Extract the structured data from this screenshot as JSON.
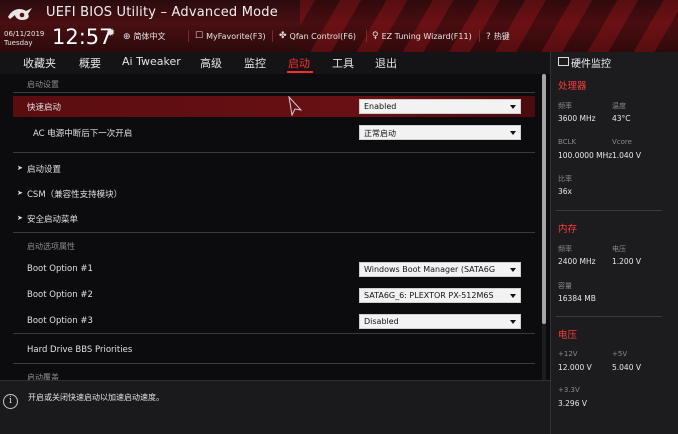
{
  "header": {
    "title": "UEFI BIOS Utility – Advanced Mode",
    "date": "06/11/2019",
    "day": "Tuesday",
    "time": "12:57",
    "items": [
      {
        "icon": "globe-icon",
        "label": "简体中文"
      },
      {
        "icon": "star-icon",
        "label": "MyFavorite(F3)"
      },
      {
        "icon": "fan-icon",
        "label": "Qfan Control(F6)"
      },
      {
        "icon": "bulb-icon",
        "label": "EZ Tuning Wizard(F11)"
      },
      {
        "icon": "hotkey-icon",
        "label": "热键"
      }
    ]
  },
  "tabs": [
    "收藏夹",
    "概要",
    "Ai Tweaker",
    "高级",
    "监控",
    "启动",
    "工具",
    "退出"
  ],
  "active_tab": "启动",
  "main": {
    "section_boot_config": "启动设置",
    "fast_boot": {
      "label": "快速启动",
      "value": "Enabled"
    },
    "ac_power": {
      "label": "AC 电源中断后下一次开启",
      "value": "正常启动"
    },
    "expanders": [
      "启动设置",
      "CSM（兼容性支持模块）",
      "安全启动菜单"
    ],
    "section_boot_options": "启动选项属性",
    "boot_options": [
      {
        "label": "Boot Option #1",
        "value": "Windows Boot Manager (SATA6G"
      },
      {
        "label": "Boot Option #2",
        "value": "SATA6G_6: PLEXTOR PX-512M6S"
      },
      {
        "label": "Boot Option #3",
        "value": "Disabled"
      }
    ],
    "hdd_bbs": "Hard Drive BBS Priorities",
    "partial_next": "启动覆盖"
  },
  "help": {
    "text": "开启或关闭快速启动以加速启动速度。"
  },
  "monitor": {
    "title": "硬件监控",
    "cpu": {
      "heading": "处理器",
      "freq_label": "频率",
      "freq": "3600 MHz",
      "temp_label": "温度",
      "temp": "43°C",
      "bclk_label": "BCLK",
      "bclk": "100.0000 MHz",
      "vcore_label": "Vcore",
      "vcore": "1.040 V",
      "ratio_label": "比率",
      "ratio": "36x"
    },
    "memory": {
      "heading": "内存",
      "freq_label": "频率",
      "freq": "2400 MHz",
      "volt_label": "电压",
      "volt": "1.200 V",
      "cap_label": "容量",
      "cap": "16384 MB"
    },
    "voltage": {
      "heading": "电压",
      "v12_label": "+12V",
      "v12": "12.000 V",
      "v5_label": "+5V",
      "v5": "5.040 V",
      "v33_label": "+3.3V",
      "v33": "3.296 V"
    }
  },
  "colors": {
    "accent": "#ff2b2b",
    "header_bg": "#4a0f12",
    "highlight_row": "#6a1013",
    "panel_bg": "#1c1c1f"
  }
}
